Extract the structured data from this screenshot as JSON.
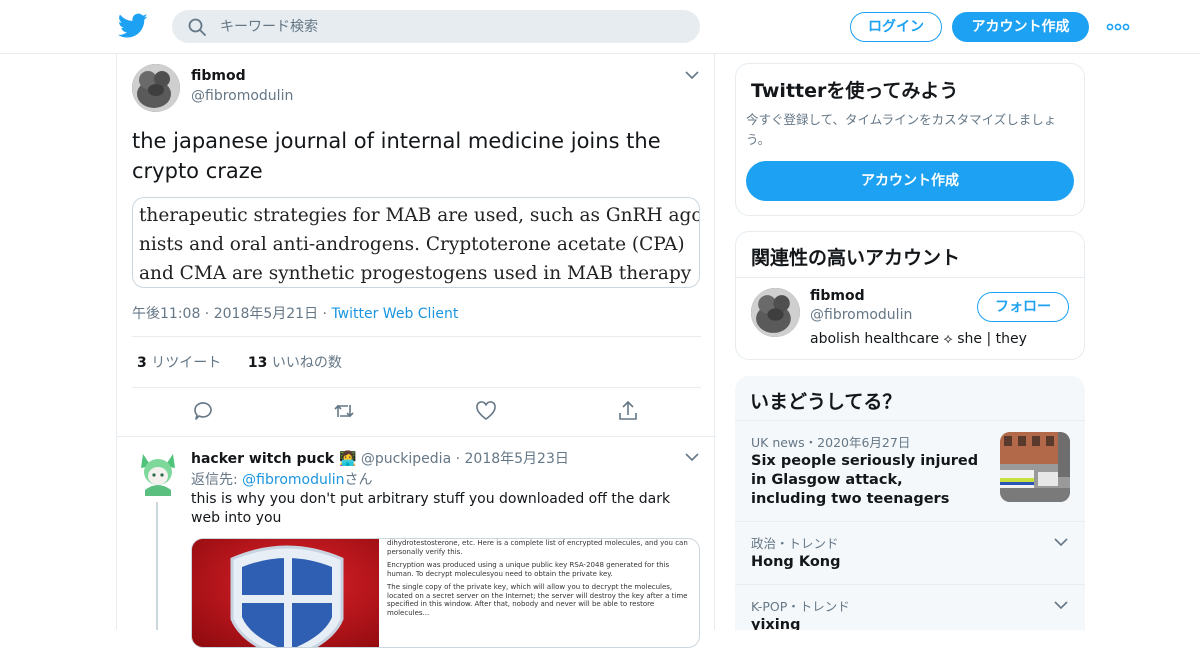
{
  "header": {
    "search_placeholder": "キーワード検索",
    "login_label": "ログイン",
    "signup_label": "アカウント作成",
    "brand_color": "#1da1f2"
  },
  "tweet": {
    "author_name": "fibmod",
    "author_handle": "@fibromodulin",
    "text": "the japanese journal of internal medicine joins the crypto craze",
    "image_lines": [
      "therapeutic strategies for MAB are used, such as GnRH ago-",
      "nists and oral anti-androgens. Cryptoterone acetate (CPA)",
      "and CMA are synthetic progestogens used in MAB therapy"
    ],
    "time": "午後11:08",
    "date": "2018年5月21日",
    "client": "Twitter Web Client",
    "retweets_count": "3",
    "retweets_label": "リツイート",
    "likes_count": "13",
    "likes_label": "いいねの数"
  },
  "reply": {
    "author_name": "hacker witch puck 👩‍💻",
    "author_handle": "@puckipedia",
    "date": "2018年5月23日",
    "reply_to_prefix": "返信先: ",
    "reply_to_mention": "@fibromodulin",
    "reply_to_suffix": "さん",
    "text": "this is why you don't put arbitrary stuff you downloaded off the dark web into you",
    "image_doc": [
      "dihydrotestosterone, etc. Here is a complete list of encrypted molecules, and you can personally verify this.",
      "Encryption was produced using a unique public key RSA-2048 generated for this human. To decrypt moleculesyou need to obtain the private key.",
      "The single copy of the private key, which will allow you to decrypt the molecules, located on a secret server on the Internet; the server will destroy the key after a time specified in this window. After that, nobody and never will be able to restore molecules..."
    ]
  },
  "sidebar": {
    "promo": {
      "title": "Twitterを使ってみよう",
      "subtitle": "今すぐ登録して、タイムラインをカスタマイズしましょう。",
      "button": "アカウント作成"
    },
    "related": {
      "title": "関連性の高いアカウント",
      "name": "fibmod",
      "handle": "@fibromodulin",
      "bio": "abolish healthcare ⟡ she | they",
      "follow_label": "フォロー"
    },
    "trends": {
      "title": "いまどうしてる？",
      "items": [
        {
          "meta": "UK news・2020年6月27日",
          "title": "Six people seriously injured in Glasgow attack, including two teenagers"
        },
        {
          "meta": "政治・トレンド",
          "title": "Hong Kong"
        },
        {
          "meta": "K-POP・トレンド",
          "title": "yixing"
        }
      ]
    }
  }
}
